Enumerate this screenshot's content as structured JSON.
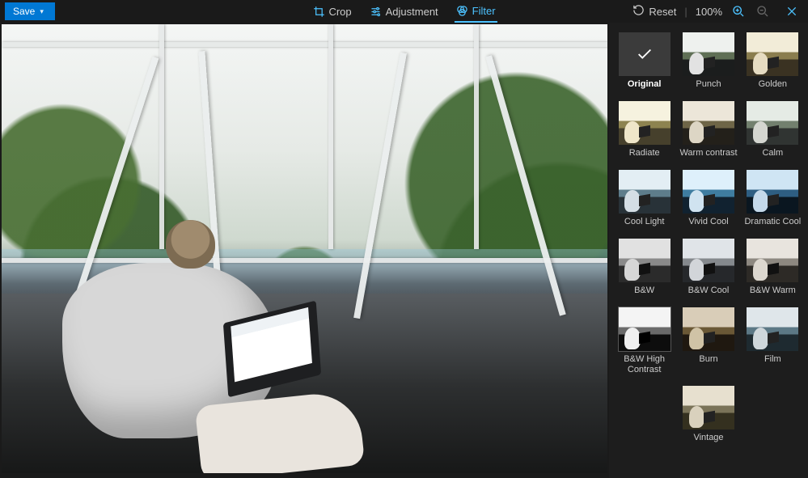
{
  "toolbar": {
    "save_label": "Save",
    "tabs": {
      "crop": "Crop",
      "adjustment": "Adjustment",
      "filter": "Filter"
    },
    "active_tab": "filter",
    "reset_label": "Reset",
    "zoom_level": "100%"
  },
  "filters": [
    {
      "id": "original",
      "label": "Original",
      "selected": true
    },
    {
      "id": "punch",
      "label": "Punch"
    },
    {
      "id": "golden",
      "label": "Golden"
    },
    {
      "id": "radiate",
      "label": "Radiate"
    },
    {
      "id": "warm-contrast",
      "label": "Warm contrast"
    },
    {
      "id": "calm",
      "label": "Calm"
    },
    {
      "id": "cool-light",
      "label": "Cool Light"
    },
    {
      "id": "vivid-cool",
      "label": "Vivid Cool"
    },
    {
      "id": "dramatic-cool",
      "label": "Dramatic Cool"
    },
    {
      "id": "bw",
      "label": "B&W"
    },
    {
      "id": "bw-cool",
      "label": "B&W Cool"
    },
    {
      "id": "bw-warm",
      "label": "B&W Warm"
    },
    {
      "id": "bw-high-contrast",
      "label": "B&W High Contrast",
      "hover": true
    },
    {
      "id": "burn",
      "label": "Burn"
    },
    {
      "id": "film",
      "label": "Film"
    },
    {
      "id": "vintage",
      "label": "Vintage",
      "single": true
    }
  ],
  "filter_styles": {
    "punch": {
      "sky": "#eef1ee",
      "mid": "#5f6f55",
      "floor": "#1b1d1d",
      "person": "#e2e2e2"
    },
    "golden": {
      "sky": "#f2ecd8",
      "mid": "#8a7d4e",
      "floor": "#3a3222",
      "person": "#e6dcc2"
    },
    "radiate": {
      "sky": "#f6f2df",
      "mid": "#8d8350",
      "floor": "#46402c",
      "person": "#efe6c9"
    },
    "warm-contrast": {
      "sky": "#ece6d9",
      "mid": "#6e6547",
      "floor": "#23201a",
      "person": "#ddd6c5"
    },
    "calm": {
      "sky": "#e5ebe5",
      "mid": "#72806e",
      "floor": "#303432",
      "person": "#d4d6d0"
    },
    "cool-light": {
      "sky": "#e3eef4",
      "mid": "#5e7d8b",
      "floor": "#283238",
      "person": "#d4dee5"
    },
    "vivid-cool": {
      "sky": "#def0fb",
      "mid": "#3f7da0",
      "floor": "#112230",
      "person": "#d0e3f0"
    },
    "dramatic-cool": {
      "sky": "#cfe5f4",
      "mid": "#2e5e82",
      "floor": "#0a1620",
      "person": "#c4d9ea"
    },
    "bw": {
      "sky": "#e1e1e1",
      "mid": "#8a8a8a",
      "floor": "#2b2b2b",
      "person": "#d6d6d6",
      "tab": "#111"
    },
    "bw-cool": {
      "sky": "#e0e4e8",
      "mid": "#85898d",
      "floor": "#26282b",
      "person": "#d2d5d9",
      "tab": "#111"
    },
    "bw-warm": {
      "sky": "#e8e4de",
      "mid": "#8d8880",
      "floor": "#2d2a26",
      "person": "#dcd7cf",
      "tab": "#111"
    },
    "bw-high-contrast": {
      "sky": "#f4f4f4",
      "mid": "#6a6a6a",
      "floor": "#0d0d0d",
      "person": "#efefef",
      "tab": "#000"
    },
    "burn": {
      "sky": "#d9cdb8",
      "mid": "#6a5836",
      "floor": "#1f1810",
      "person": "#d0c3a6"
    },
    "film": {
      "sky": "#dfe6ea",
      "mid": "#5c7885",
      "floor": "#1e2a30",
      "person": "#cfd7db"
    },
    "vintage": {
      "sky": "#e7e0cf",
      "mid": "#7a7358",
      "floor": "#34301f",
      "person": "#d9d1bd"
    }
  }
}
